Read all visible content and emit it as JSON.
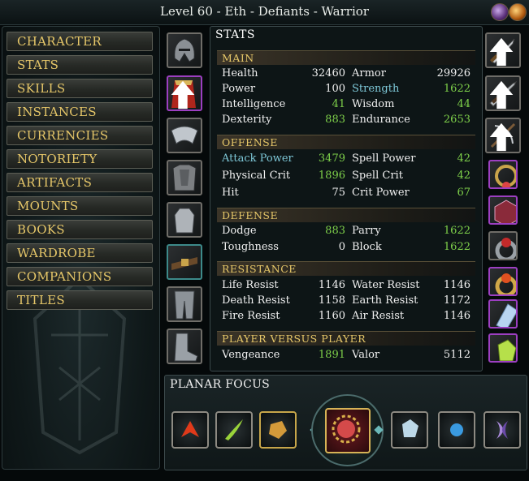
{
  "header": {
    "title": "Level 60 - Eth - Defiants - Warrior"
  },
  "nav": [
    "CHARACTER",
    "STATS",
    "SKILLS",
    "INSTANCES",
    "CURRENCIES",
    "NOTORIETY",
    "ARTIFACTS",
    "MOUNTS",
    "BOOKS",
    "WARDROBE",
    "COMPANIONS",
    "TITLES"
  ],
  "stats": {
    "title": "STATS",
    "main": {
      "heading": "MAIN",
      "rows": [
        {
          "l1": "Health",
          "v1": "32460",
          "l2": "Armor",
          "v2": "29926"
        },
        {
          "l1": "Power",
          "v1": "100",
          "l2": "Strength",
          "v2": "1622"
        },
        {
          "l1": "Intelligence",
          "v1": "41",
          "l2": "Wisdom",
          "v2": "44"
        },
        {
          "l1": "Dexterity",
          "v1": "883",
          "l2": "Endurance",
          "v2": "2653"
        }
      ]
    },
    "offense": {
      "heading": "OFFENSE",
      "rows": [
        {
          "l1": "Attack Power",
          "v1": "3479",
          "l2": "Spell Power",
          "v2": "42"
        },
        {
          "l1": "Physical Crit",
          "v1": "1896",
          "l2": "Spell Crit",
          "v2": "42"
        },
        {
          "l1": "Hit",
          "v1": "75",
          "l2": "Crit Power",
          "v2": "67"
        }
      ]
    },
    "defense": {
      "heading": "DEFENSE",
      "rows": [
        {
          "l1": "Dodge",
          "v1": "883",
          "l2": "Parry",
          "v2": "1622"
        },
        {
          "l1": "Toughness",
          "v1": "0",
          "l2": "Block",
          "v2": "1622"
        }
      ]
    },
    "resistance": {
      "heading": "RESISTANCE",
      "rows": [
        {
          "l1": "Life Resist",
          "v1": "1146",
          "l2": "Water Resist",
          "v2": "1146"
        },
        {
          "l1": "Death Resist",
          "v1": "1158",
          "l2": "Earth Resist",
          "v2": "1172"
        },
        {
          "l1": "Fire Resist",
          "v1": "1160",
          "l2": "Air Resist",
          "v2": "1146"
        }
      ]
    },
    "pvp": {
      "heading": "PLAYER VERSUS PLAYER",
      "rows": [
        {
          "l1": "Vengeance",
          "v1": "1891",
          "l2": "Valor",
          "v2": "5112"
        }
      ]
    }
  },
  "planar": {
    "title": "PLANAR FOCUS"
  },
  "icons": {
    "left_slots": [
      "helmet-icon",
      "cape-icon",
      "shoulders-icon",
      "chest-armor-icon",
      "gloves-icon",
      "belt-icon",
      "leggings-icon",
      "boots-icon"
    ],
    "right_slots": [
      "sword-icon",
      "offhand-sword-icon",
      "crossbow-icon",
      "necklace-icon",
      "seal-icon",
      "ring-icon",
      "gold-ring-icon",
      "crystal-icon",
      "essence-icon"
    ],
    "planar_slots": [
      "fire-planar-icon",
      "life-planar-icon",
      "earth-planar-icon",
      "major-essence-icon",
      "water-planar-icon",
      "air-planar-icon",
      "death-planar-icon"
    ]
  },
  "colors": {
    "gold": "#e6c769",
    "green": "#7ed04a",
    "highlight": "#7ec8d8",
    "purple_border": "#9c3fc1"
  }
}
